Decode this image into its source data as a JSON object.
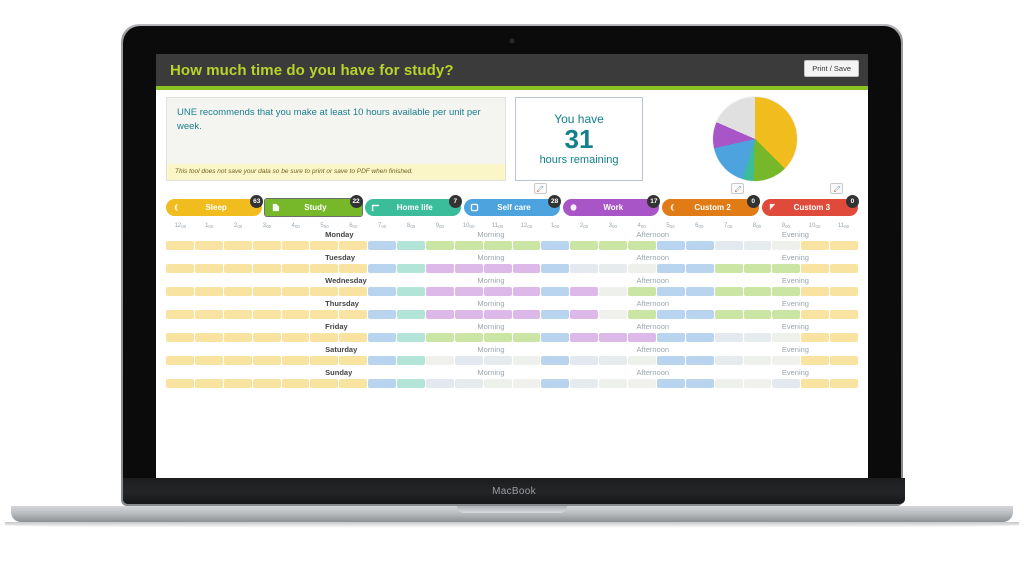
{
  "device": {
    "label": "MacBook"
  },
  "header": {
    "title": "How much time do you have for study?",
    "print_button": "Print / Save"
  },
  "info": {
    "text": "UNE recommends that you make at least 10 hours available per unit per week.",
    "note": "This tool does not save your data so be sure to print or save to PDF when finished."
  },
  "hours_panel": {
    "top_label": "You have",
    "value": "31",
    "bottom_label": "hours remaining",
    "accent": "#14808c"
  },
  "categories": [
    {
      "id": "sleep",
      "label": "Sleep",
      "count": "63",
      "color": "#f0bc1e",
      "cell": "#f8e3a0",
      "icon": "moon-icon",
      "selected": false
    },
    {
      "id": "study",
      "label": "Study",
      "count": "22",
      "color": "#76b82a",
      "cell": "#cbe5a4",
      "icon": "book-icon",
      "selected": true
    },
    {
      "id": "homelife",
      "label": "Home life",
      "count": "7",
      "color": "#3bbd9b",
      "cell": "#b2e5d7",
      "icon": "house-icon",
      "selected": false
    },
    {
      "id": "selfcare",
      "label": "Self care",
      "count": "28",
      "color": "#4da3de",
      "cell": "#b8d4ee",
      "icon": "heart-icon",
      "selected": false
    },
    {
      "id": "work",
      "label": "Work",
      "count": "17",
      "color": "#a855c8",
      "cell": "#dcb9e8",
      "icon": "bag-icon",
      "selected": false
    },
    {
      "id": "custom2",
      "label": "Custom 2",
      "count": "0",
      "color": "#e07b16",
      "cell": "#f3cfa3",
      "icon": "moon-icon",
      "selected": false
    },
    {
      "id": "custom3",
      "label": "Custom 3",
      "count": "0",
      "color": "#e04a3a",
      "cell": "#f3b3ac",
      "icon": "flag-icon",
      "selected": false
    }
  ],
  "empty_cell_colors": [
    "#e6ebee",
    "#eef0ec",
    "#f0f0ec",
    "#e3e9ee"
  ],
  "hours": [
    "12:00",
    "1:00",
    "2:00",
    "3:00",
    "4:00",
    "5:00",
    "6:00",
    "7:00",
    "8:00",
    "9:00",
    "10:00",
    "11:00",
    "12:00",
    "1:00",
    "2:00",
    "3:00",
    "4:00",
    "5:00",
    "6:00",
    "7:00",
    "8:00",
    "9:00",
    "10:00",
    "11:00"
  ],
  "part_labels": [
    "Morning",
    "Afternoon",
    "Evening"
  ],
  "schedule": [
    {
      "day": "Monday",
      "cells": [
        "sleep",
        "sleep",
        "sleep",
        "sleep",
        "sleep",
        "sleep",
        "sleep",
        "selfcare",
        "homelife",
        "study",
        "study",
        "study",
        "study",
        "selfcare",
        "study",
        "study",
        "study",
        "selfcare",
        "selfcare",
        "",
        "",
        "",
        "sleep",
        "sleep"
      ]
    },
    {
      "day": "Tuesday",
      "cells": [
        "sleep",
        "sleep",
        "sleep",
        "sleep",
        "sleep",
        "sleep",
        "sleep",
        "selfcare",
        "homelife",
        "work",
        "work",
        "work",
        "work",
        "selfcare",
        "",
        "",
        "",
        "selfcare",
        "selfcare",
        "study",
        "study",
        "study",
        "sleep",
        "sleep"
      ]
    },
    {
      "day": "Wednesday",
      "cells": [
        "sleep",
        "sleep",
        "sleep",
        "sleep",
        "sleep",
        "sleep",
        "sleep",
        "selfcare",
        "homelife",
        "work",
        "work",
        "work",
        "work",
        "selfcare",
        "work",
        "",
        "study",
        "selfcare",
        "selfcare",
        "study",
        "study",
        "study",
        "sleep",
        "sleep"
      ]
    },
    {
      "day": "Thursday",
      "cells": [
        "sleep",
        "sleep",
        "sleep",
        "sleep",
        "sleep",
        "sleep",
        "sleep",
        "selfcare",
        "homelife",
        "work",
        "work",
        "work",
        "work",
        "selfcare",
        "work",
        "",
        "study",
        "selfcare",
        "selfcare",
        "study",
        "study",
        "study",
        "sleep",
        "sleep"
      ]
    },
    {
      "day": "Friday",
      "cells": [
        "sleep",
        "sleep",
        "sleep",
        "sleep",
        "sleep",
        "sleep",
        "sleep",
        "selfcare",
        "homelife",
        "study",
        "study",
        "study",
        "study",
        "selfcare",
        "work",
        "work",
        "work",
        "selfcare",
        "selfcare",
        "",
        "",
        "",
        "sleep",
        "sleep"
      ]
    },
    {
      "day": "Saturday",
      "cells": [
        "sleep",
        "sleep",
        "sleep",
        "sleep",
        "sleep",
        "sleep",
        "sleep",
        "selfcare",
        "homelife",
        "",
        "",
        "",
        "",
        "selfcare",
        "",
        "",
        "",
        "selfcare",
        "selfcare",
        "",
        "",
        "",
        "sleep",
        "sleep"
      ]
    },
    {
      "day": "Sunday",
      "cells": [
        "sleep",
        "sleep",
        "sleep",
        "sleep",
        "sleep",
        "sleep",
        "sleep",
        "selfcare",
        "homelife",
        "",
        "",
        "",
        "",
        "selfcare",
        "",
        "",
        "",
        "selfcare",
        "selfcare",
        "",
        "",
        "",
        "sleep",
        "sleep"
      ]
    }
  ],
  "chart_data": {
    "type": "pie",
    "title": "",
    "legend_position": "above",
    "labels": [
      "Sleep",
      "Study",
      "Home life",
      "Self care",
      "Work",
      "Remaining"
    ],
    "values": [
      63,
      22,
      7,
      28,
      17,
      31
    ],
    "colors": [
      "#f0bc1e",
      "#76b82a",
      "#3bbd9b",
      "#4da3de",
      "#a855c8",
      "#e0e0e0"
    ],
    "unit": "hours",
    "total": 168
  },
  "theme": {
    "topbar_bg": "#3b3b3b",
    "title_color": "#b9d32a",
    "green_bar": "#8bc220"
  }
}
